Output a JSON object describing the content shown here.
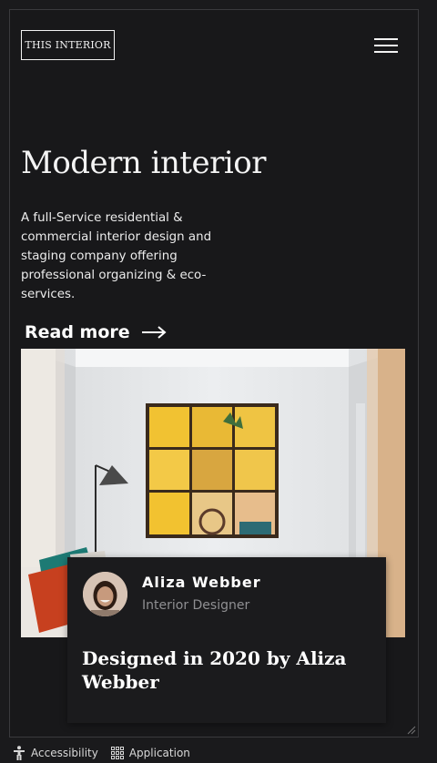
{
  "header": {
    "logo_text": "THIS INTERIOR",
    "menu_icon": "hamburger-menu-icon"
  },
  "hero": {
    "title": "Modern interior",
    "description": "A full-Service residential & commercial interior design and staging company offering professional organizing & eco-services.",
    "read_more_label": "Read more",
    "read_more_icon": "arrow-right-icon"
  },
  "card": {
    "name": "Aliza Webber",
    "role": "Interior Designer",
    "title": "Designed in 2020 by Aliza Webber"
  },
  "statusbar": {
    "accessibility_label": "Accessibility",
    "application_label": "Application"
  },
  "colors": {
    "background": "#18181a",
    "text": "#f4f4f4",
    "muted": "#8f8f92",
    "art_yellow": "#f1c232"
  }
}
